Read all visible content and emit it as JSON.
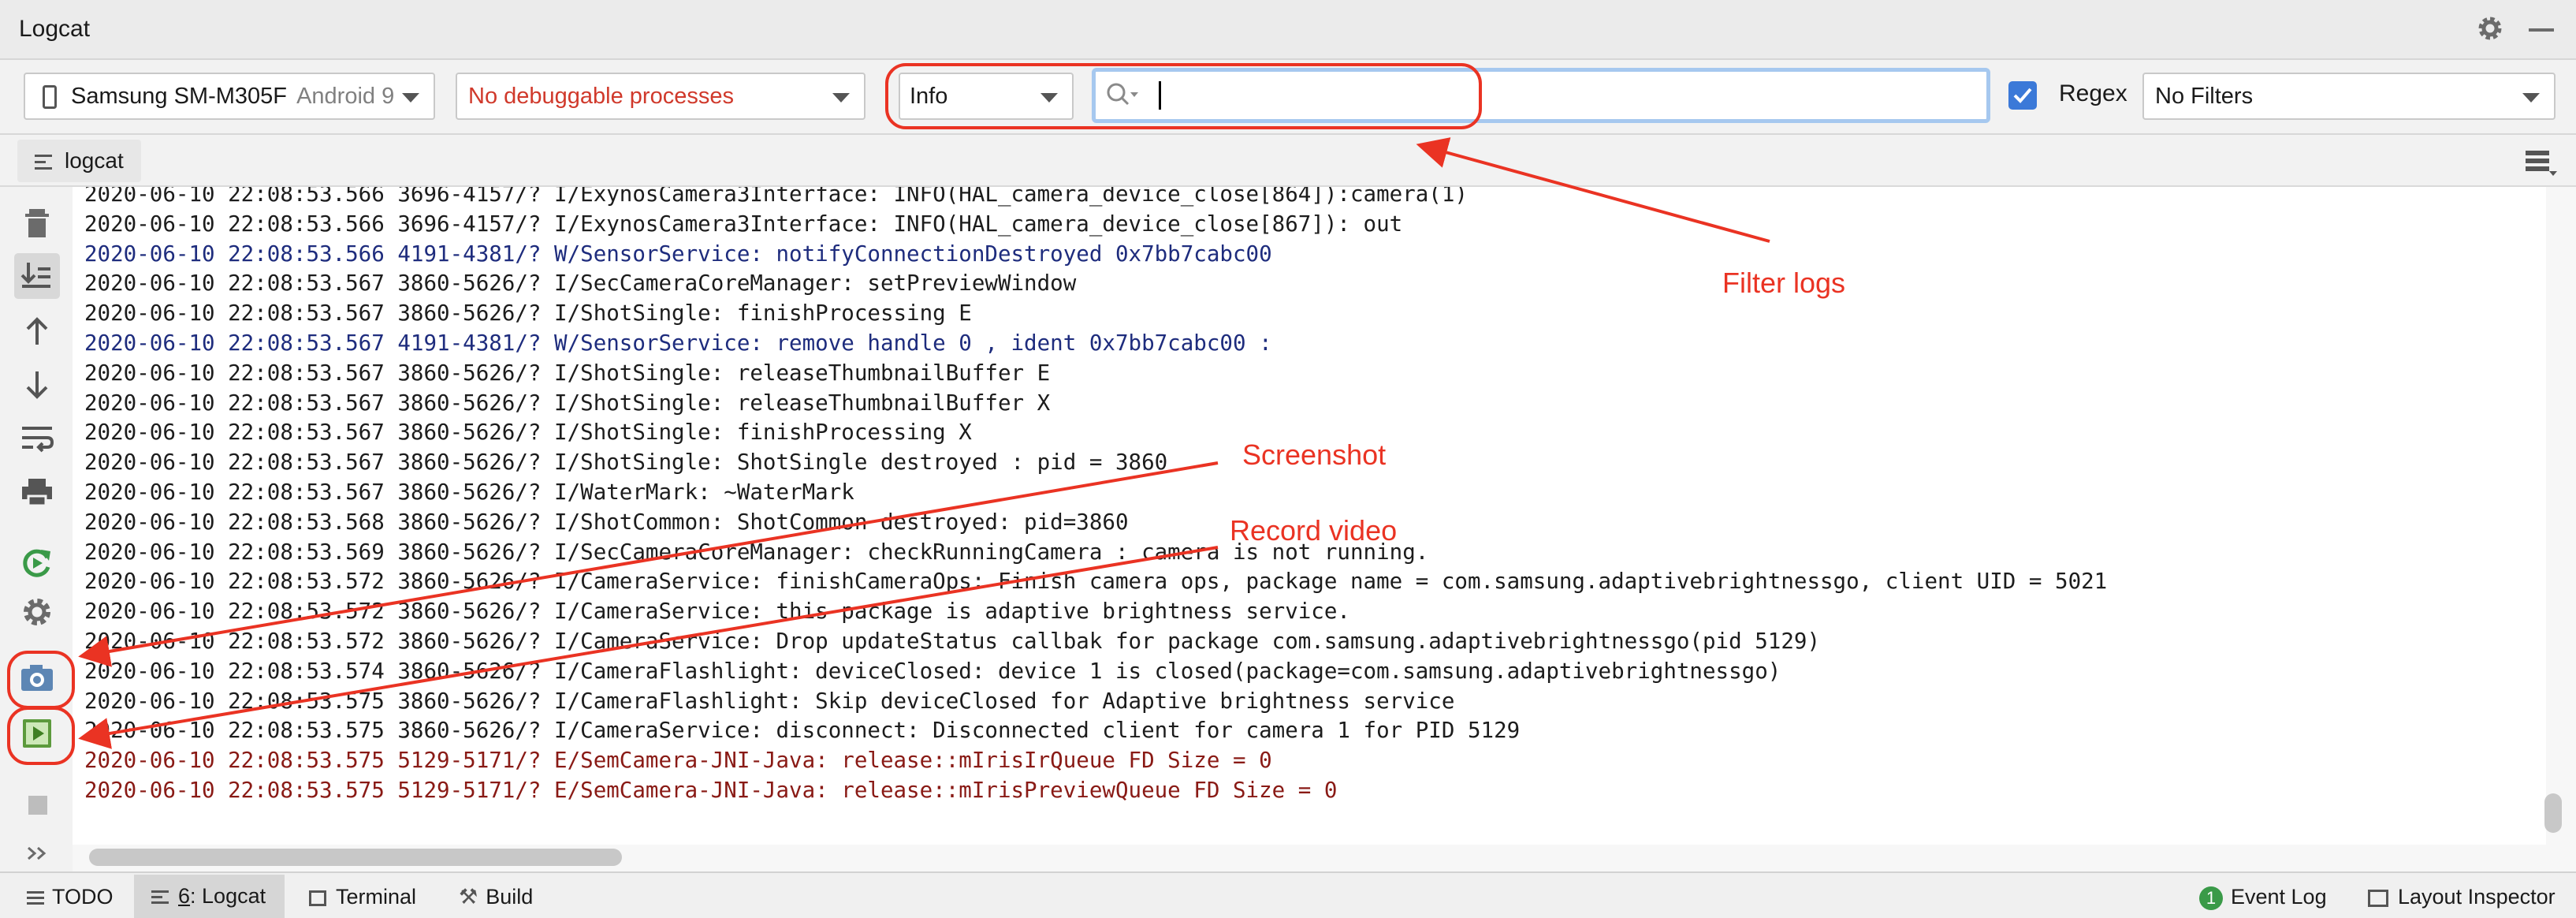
{
  "window": {
    "title": "Logcat"
  },
  "toolbar": {
    "device": {
      "name": "Samsung SM-M305F",
      "version": "Android 9"
    },
    "process": {
      "text": "No debuggable processes",
      "color": "#d0392b"
    },
    "log_level": "Info",
    "search": {
      "value": "",
      "placeholder": ""
    },
    "regex": {
      "label": "Regex",
      "checked": true
    },
    "filter": "No Filters"
  },
  "tabs": [
    {
      "label": "logcat"
    }
  ],
  "left_tools": [
    "trash-icon",
    "scroll-to-end-icon",
    "arrow-up-icon",
    "arrow-down-icon",
    "soft-wrap-icon",
    "print-icon",
    "restart-icon",
    "settings-icon",
    "screenshot-icon",
    "record-video-icon",
    "stop-icon",
    "more-icon"
  ],
  "log_lines": [
    {
      "text": "2020-06-10 22:08:53.566 3696-4157/? I/ExynosCamera3Interface: INFO(HAL_camera_device_close[864]):camera(1)",
      "level": "info"
    },
    {
      "text": "2020-06-10 22:08:53.566 3696-4157/? I/ExynosCamera3Interface: INFO(HAL_camera_device_close[867]): out",
      "level": "info"
    },
    {
      "text": "2020-06-10 22:08:53.566 4191-4381/? W/SensorService: notifyConnectionDestroyed 0x7bb7cabc00",
      "level": "warn"
    },
    {
      "text": "2020-06-10 22:08:53.567 3860-5626/? I/SecCameraCoreManager: setPreviewWindow",
      "level": "info"
    },
    {
      "text": "2020-06-10 22:08:53.567 3860-5626/? I/ShotSingle: finishProcessing E",
      "level": "info"
    },
    {
      "text": "2020-06-10 22:08:53.567 4191-4381/? W/SensorService: remove handle 0 , ident 0x7bb7cabc00 :",
      "level": "warn"
    },
    {
      "text": "2020-06-10 22:08:53.567 3860-5626/? I/ShotSingle: releaseThumbnailBuffer E",
      "level": "info"
    },
    {
      "text": "2020-06-10 22:08:53.567 3860-5626/? I/ShotSingle: releaseThumbnailBuffer X",
      "level": "info"
    },
    {
      "text": "2020-06-10 22:08:53.567 3860-5626/? I/ShotSingle: finishProcessing X",
      "level": "info"
    },
    {
      "text": "2020-06-10 22:08:53.567 3860-5626/? I/ShotSingle: ShotSingle destroyed : pid = 3860",
      "level": "info"
    },
    {
      "text": "2020-06-10 22:08:53.567 3860-5626/? I/WaterMark: ~WaterMark",
      "level": "info"
    },
    {
      "text": "2020-06-10 22:08:53.568 3860-5626/? I/ShotCommon: ShotCommon destroyed: pid=3860",
      "level": "info"
    },
    {
      "text": "2020-06-10 22:08:53.569 3860-5626/? I/SecCameraCoreManager: checkRunningCamera : camera is not running.",
      "level": "info"
    },
    {
      "text": "2020-06-10 22:08:53.572 3860-5626/? I/CameraService: finishCameraOps: Finish camera ops, package name = com.samsung.adaptivebrightnessgo, client UID = 5021",
      "level": "info"
    },
    {
      "text": "2020-06-10 22:08:53.572 3860-5626/? I/CameraService: this package is adaptive brightness service.",
      "level": "info"
    },
    {
      "text": "2020-06-10 22:08:53.572 3860-5626/? I/CameraService: Drop updateStatus callbak for package com.samsung.adaptivebrightnessgo(pid 5129)",
      "level": "info"
    },
    {
      "text": "2020-06-10 22:08:53.574 3860-5626/? I/CameraFlashlight: deviceClosed: device 1 is closed(package=com.samsung.adaptivebrightnessgo)",
      "level": "info"
    },
    {
      "text": "2020-06-10 22:08:53.575 3860-5626/? I/CameraFlashlight: Skip deviceClosed for Adaptive brightness service",
      "level": "info"
    },
    {
      "text": "2020-06-10 22:08:53.575 3860-5626/? I/CameraService: disconnect: Disconnected client for camera 1 for PID 5129",
      "level": "info"
    },
    {
      "text": "2020-06-10 22:08:53.575 5129-5171/? E/SemCamera-JNI-Java: release::mIrisIrQueue FD Size = 0",
      "level": "error"
    },
    {
      "text": "2020-06-10 22:08:53.575 5129-5171/? E/SemCamera-JNI-Java: release::mIrisPreviewQueue FD Size = 0",
      "level": "error"
    }
  ],
  "annotations": {
    "filter_logs": "Filter logs",
    "screenshot": "Screenshot",
    "record_video": "Record video",
    "color": "#ea3323"
  },
  "statusbar": {
    "todo": "TODO",
    "logcat_num": "6",
    "logcat_label": ": Logcat",
    "terminal": "Terminal",
    "build": "Build",
    "event_log_badge": "1",
    "event_log": "Event Log",
    "layout_inspector": "Layout Inspector"
  },
  "colors": {
    "info": "#1c1c1c",
    "warn": "#1e2c7d",
    "error": "#891a15",
    "accent": "#3b79d8"
  }
}
